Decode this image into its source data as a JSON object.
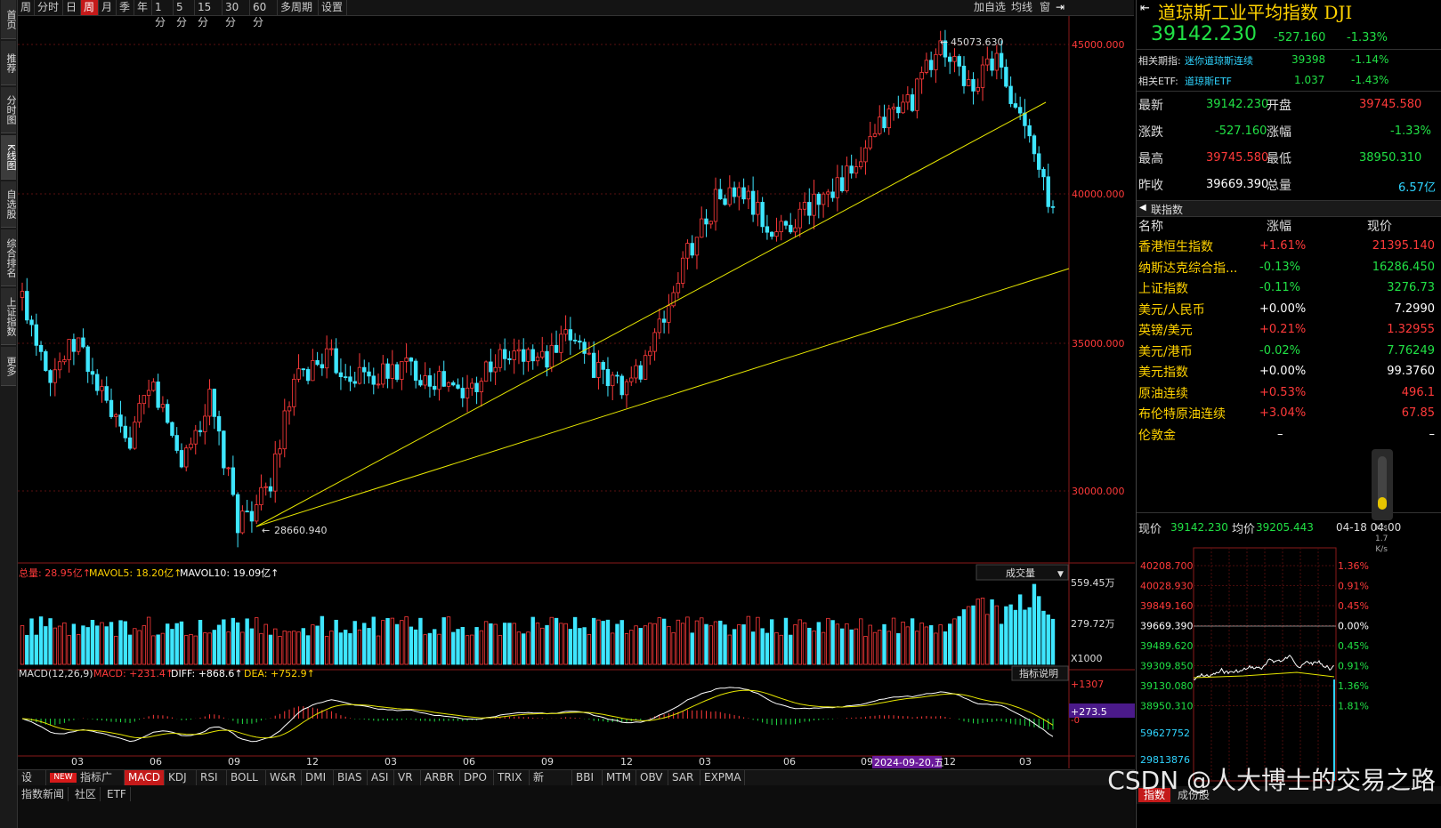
{
  "leftnav": [
    "首页",
    "推荐",
    "分时图",
    "K线图",
    "自选股",
    "综合排名",
    "上证指数",
    "更多"
  ],
  "toolbar": {
    "items": [
      "周",
      "分时",
      "日",
      "周",
      "月",
      "季",
      "年",
      "1分",
      "5分",
      "15分",
      "30分",
      "60分",
      "多周期",
      "设置"
    ],
    "active_index": 3,
    "right": [
      "加自选",
      "均线",
      "窗"
    ]
  },
  "chart": {
    "price_labels": [
      "45000.000",
      "40000.000",
      "35000.000",
      "30000.000"
    ],
    "high_annotation": "45073.630",
    "low_annotation": "28660.940",
    "volume_header": {
      "total": "总量: 28.95亿↑",
      "mavol5": "MAVOL5: 18.20亿↑",
      "mavol10": "MAVOL10: 19.09亿↑",
      "selector": "成交量"
    },
    "volume_labels": [
      "559.45万",
      "279.72万",
      "X1000"
    ],
    "macd_header": {
      "title": "MACD(12,26,9)",
      "macd": "MACD: +231.4↑",
      "diff": "DIFF: +868.6↑",
      "dea": "DEA: +752.9↑",
      "explain": "指标说明"
    },
    "macd_labels": [
      "+1307",
      "+273.5",
      "-0"
    ],
    "x_labels": [
      "03",
      "06",
      "09",
      "12",
      "03",
      "06",
      "09",
      "12",
      "03",
      "06",
      "09",
      "12",
      "03"
    ],
    "date_highlight": "2024-09-20,五"
  },
  "indicator_tabs": {
    "items": [
      "设置",
      "NEW",
      "指标广场",
      "MACD",
      "KDJ",
      "RSI",
      "BOLL",
      "W&R",
      "DMI",
      "BIAS",
      "ASI",
      "VR",
      "ARBR",
      "DPO",
      "TRIX",
      "新DMA",
      "BBI",
      "MTM",
      "OBV",
      "SAR",
      "EXPMA"
    ],
    "active": "MACD"
  },
  "bottombar": [
    "指数新闻",
    "社区",
    "ETF"
  ],
  "panel": {
    "title": "道琼斯工业平均指数 DJI",
    "price": "39142.230",
    "change": "-527.160",
    "change_pct": "-1.33%",
    "futures_label": "相关期指:",
    "futures_name": "迷你道琼斯连续",
    "futures_price": "39398",
    "futures_pct": "-1.14%",
    "etf_label": "相关ETF:",
    "etf_name": "道琼斯ETF",
    "etf_price": "1.037",
    "etf_pct": "-1.43%",
    "stats": [
      {
        "l1": "最新",
        "v1": "39142.230",
        "c1": "green",
        "l2": "开盘",
        "v2": "39745.580",
        "c2": "red"
      },
      {
        "l1": "涨跌",
        "v1": "-527.160",
        "c1": "green",
        "l2": "涨幅",
        "v2": "-1.33%",
        "c2": "green"
      },
      {
        "l1": "最高",
        "v1": "39745.580",
        "c1": "red",
        "l2": "最低",
        "v2": "38950.310",
        "c2": "green"
      },
      {
        "l1": "昨收",
        "v1": "39669.390",
        "c1": "white",
        "l2": "总量",
        "v2": "6.57亿",
        "c2": "cyan"
      }
    ],
    "related_header": "联指数",
    "related_cols": [
      "名称",
      "涨幅",
      "现价"
    ],
    "related": [
      {
        "name": "香港恒生指数",
        "pct": "+1.61%",
        "price": "21395.140",
        "c": "red"
      },
      {
        "name": "纳斯达克综合指...",
        "pct": "-0.13%",
        "price": "16286.450",
        "c": "green"
      },
      {
        "name": "上证指数",
        "pct": "-0.11%",
        "price": "3276.73",
        "c": "green"
      },
      {
        "name": "美元/人民币",
        "pct": "+0.00%",
        "price": "7.2990",
        "c": "white"
      },
      {
        "name": "英镑/美元",
        "pct": "+0.21%",
        "price": "1.32955",
        "c": "red"
      },
      {
        "name": "美元/港币",
        "pct": "-0.02%",
        "price": "7.76249",
        "c": "green"
      },
      {
        "name": "美元指数",
        "pct": "+0.00%",
        "price": "99.3760",
        "c": "white"
      },
      {
        "name": "原油连续",
        "pct": "+0.53%",
        "price": "496.1",
        "c": "red"
      },
      {
        "name": "布伦特原油连续",
        "pct": "+3.04%",
        "price": "67.85",
        "c": "red"
      },
      {
        "name": "伦敦金",
        "pct": "–",
        "price": "–",
        "c": "white"
      }
    ],
    "intraday": {
      "label_price": "现价",
      "price": "39142.230",
      "label_avg": "均价",
      "avg": "39205.443",
      "date": "04-18 04:00",
      "left_axis": [
        "40208.700",
        "40028.930",
        "39849.160",
        "39669.390",
        "39489.620",
        "39309.850",
        "39130.080",
        "38950.310",
        "59627752",
        "29813876"
      ],
      "right_axis": [
        "1.36%",
        "0.91%",
        "0.45%",
        "0.00%",
        "0.45%",
        "0.91%",
        "1.36%",
        "1.81%"
      ],
      "speed": [
        "K/s",
        "1.7",
        "K/s"
      ],
      "tabs": [
        "指数",
        "成份股"
      ]
    }
  },
  "watermark": "CSDN @人大博士的交易之路"
}
